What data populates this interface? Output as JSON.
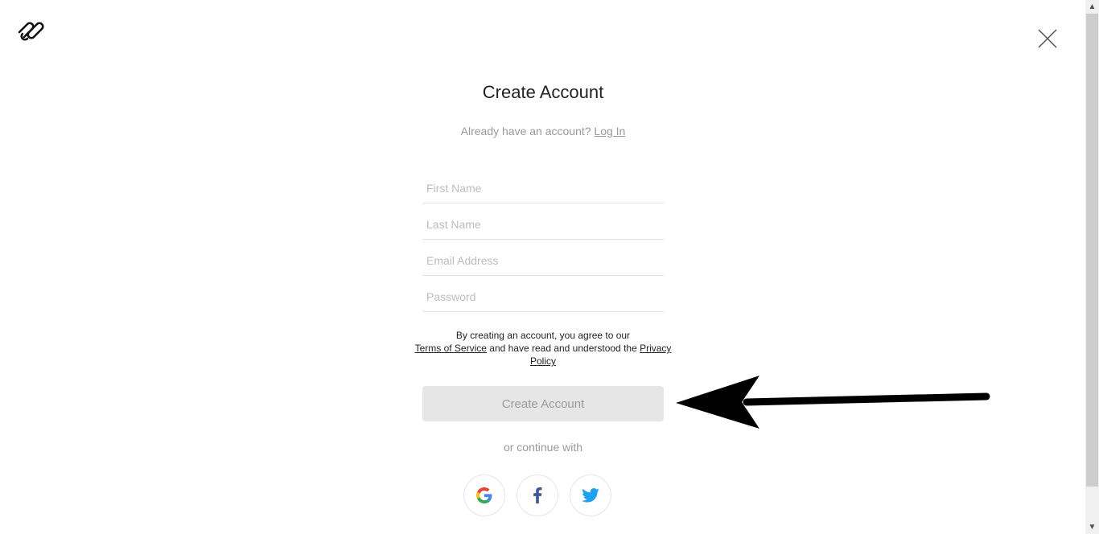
{
  "header": {
    "logo_icon": "squarespace-logo-icon",
    "close_icon": "close-icon"
  },
  "form": {
    "title": "Create Account",
    "login_prompt": "Already have an account?",
    "login_link": "Log In",
    "fields": {
      "first_name": {
        "placeholder": "First Name",
        "value": ""
      },
      "last_name": {
        "placeholder": "Last Name",
        "value": ""
      },
      "email": {
        "placeholder": "Email Address",
        "value": ""
      },
      "password": {
        "placeholder": "Password",
        "value": ""
      }
    },
    "terms": {
      "prefix": "By creating an account, you agree to our",
      "tos_link": "Terms of Service",
      "middle": "and have read and understood the",
      "privacy_link": "Privacy Policy"
    },
    "submit_label": "Create Account",
    "or_continue": "or continue with",
    "social": [
      {
        "name": "Google",
        "icon": "google-icon"
      },
      {
        "name": "Facebook",
        "icon": "facebook-icon"
      },
      {
        "name": "Twitter",
        "icon": "twitter-icon"
      }
    ]
  },
  "annotation": {
    "icon": "arrow-left-icon"
  },
  "colors": {
    "facebook": "#3b5998",
    "twitter": "#1da1f2",
    "button_bg": "#e6e6e6"
  }
}
